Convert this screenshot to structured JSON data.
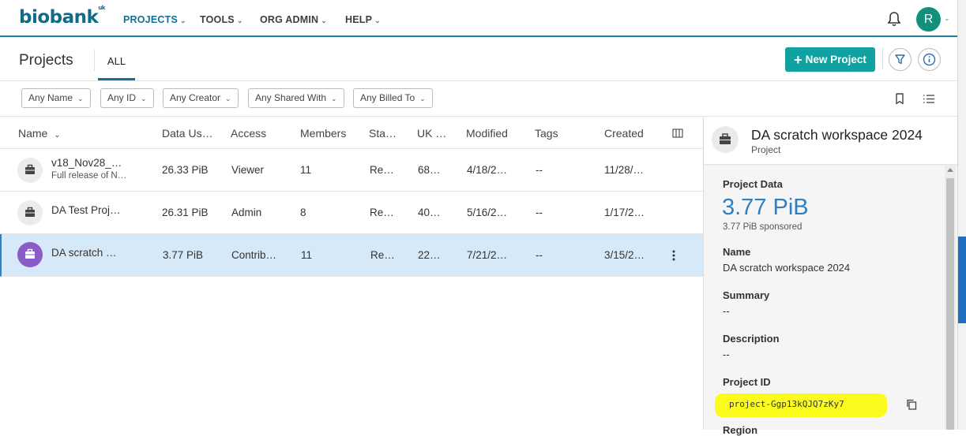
{
  "nav": {
    "logo": "biobank",
    "logo_sup": "uk",
    "items": [
      {
        "label": "PROJECTS"
      },
      {
        "label": "TOOLS"
      },
      {
        "label": "ORG ADMIN"
      },
      {
        "label": "HELP"
      }
    ],
    "avatar_initial": "R"
  },
  "header": {
    "title": "Projects",
    "tab": "ALL",
    "new_project_label": "New Project"
  },
  "filters": [
    "Any Name",
    "Any ID",
    "Any Creator",
    "Any Shared With",
    "Any Billed To"
  ],
  "table": {
    "columns": [
      "Name",
      "Data Us…",
      "Access",
      "Members",
      "Sta…",
      "UK …",
      "Modified",
      "Tags",
      "Created"
    ],
    "rows": [
      {
        "name": "v18_Nov28_…",
        "subtitle": "Full release of N…",
        "data_usage": "26.33 PiB",
        "access": "Viewer",
        "members": "11",
        "status": "Re…",
        "uk": "68…",
        "modified": "4/18/2…",
        "tags": "--",
        "created": "11/28/…"
      },
      {
        "name": "DA Test Proj…",
        "subtitle": "",
        "data_usage": "26.31 PiB",
        "access": "Admin",
        "members": "8",
        "status": "Re…",
        "uk": "40…",
        "modified": "5/16/2…",
        "tags": "--",
        "created": "1/17/2…"
      },
      {
        "name": "DA scratch …",
        "subtitle": "",
        "data_usage": "3.77 PiB",
        "access": "Contrib…",
        "members": "11",
        "status": "Re…",
        "uk": "22…",
        "modified": "7/21/2…",
        "tags": "--",
        "created": "3/15/2…"
      }
    ]
  },
  "details": {
    "title": "DA scratch workspace 2024",
    "type": "Project",
    "project_data_label": "Project Data",
    "project_data_value": "3.77 PiB",
    "project_data_sub": "3.77 PiB sponsored",
    "name_label": "Name",
    "name_value": "DA scratch workspace 2024",
    "summary_label": "Summary",
    "summary_value": "--",
    "description_label": "Description",
    "description_value": "--",
    "project_id_label": "Project ID",
    "project_id_value": "project-Ggp13kQJQ7zKy7",
    "next_label": "Region"
  },
  "colors": {
    "brand": "#13708f",
    "accent": "#10a2a0",
    "selected_row": "#d6e9f8",
    "highlight": "#fbfb1e"
  }
}
